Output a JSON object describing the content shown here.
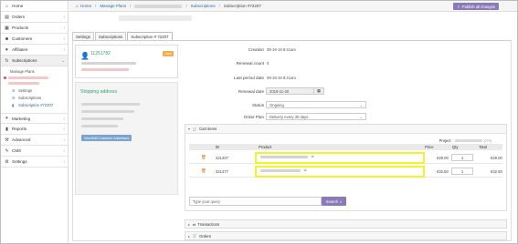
{
  "sidebar": {
    "items": [
      {
        "label": "Home",
        "icon": "home-icon",
        "glyph": "⌂",
        "arrow": ""
      },
      {
        "label": "Orders",
        "icon": "orders-icon",
        "glyph": "▤",
        "arrow": "‹"
      },
      {
        "label": "Products",
        "icon": "products-icon",
        "glyph": "▦",
        "arrow": "‹"
      },
      {
        "label": "Customers",
        "icon": "customers-icon",
        "glyph": "☻",
        "arrow": "‹"
      },
      {
        "label": "Affiliates",
        "icon": "affiliates-icon",
        "glyph": "♥",
        "arrow": "‹"
      },
      {
        "label": "Subscriptions",
        "icon": "subscriptions-icon",
        "glyph": "↻",
        "arrow": "⌄"
      }
    ],
    "subscriptions_sub": {
      "manage_plans": "Manage Plans",
      "settings": "Settings",
      "subscriptions": "Subscriptions",
      "current": "Subscription #72207"
    },
    "lower_items": [
      {
        "label": "Marketing",
        "icon": "marketing-icon",
        "glyph": "✈",
        "arrow": "‹"
      },
      {
        "label": "Reports",
        "icon": "reports-icon",
        "glyph": "▮",
        "arrow": "‹"
      },
      {
        "label": "Advanced",
        "icon": "advanced-icon",
        "glyph": "⚒",
        "arrow": "‹"
      },
      {
        "label": "CMS",
        "icon": "cms-icon",
        "glyph": "✎",
        "arrow": "‹"
      },
      {
        "label": "Settings",
        "icon": "settings-icon",
        "glyph": "⚙",
        "arrow": "‹"
      }
    ]
  },
  "breadcrumb": {
    "home": "Home",
    "manage_plans": "Manage Plans",
    "subscriptions": "Subscriptions",
    "current": "Subscription #72207"
  },
  "toolbar": {
    "publish_label": "Publish all changes"
  },
  "tabs": [
    {
      "label": "Settings"
    },
    {
      "label": "Subscriptions"
    },
    {
      "label": "Subscription # 72207"
    }
  ],
  "customer": {
    "id": "11251782",
    "badge": "Card"
  },
  "shipping": {
    "heading": "Shipping address",
    "button_label": "View/Edit Customer Addresses"
  },
  "details": {
    "creation_label": "Creation",
    "creation_value": "08-19-19 8:41am",
    "renewal_count_label": "Renewal count",
    "renewal_count_value": "0",
    "last_period_label": "Last period date",
    "last_period_value": "08-19-19 8:41am",
    "renewal_date_label": "Renewal date",
    "renewal_date_value": "2019-11-20",
    "status_label": "Status",
    "status_value": "Ongoing",
    "order_plan_label": "Order Plan",
    "order_plan_value": "Delivery every 30 days"
  },
  "cart": {
    "heading": "Cart items",
    "project_label": "Project",
    "project_count": "(???)",
    "columns": {
      "id": "ID",
      "product": "Product",
      "price": "Price",
      "qty": "Qty",
      "total": "Total"
    },
    "rows": [
      {
        "id": "421207",
        "price": "€29.00",
        "qty": "1",
        "total": "€29.00"
      },
      {
        "id": "421477",
        "price": "€32.50",
        "qty": "1",
        "total": "€32.50"
      }
    ],
    "query_placeholder": "Type your query",
    "search_label": "Search"
  },
  "sections": {
    "transactions": "Transactions",
    "orders": "Orders"
  }
}
